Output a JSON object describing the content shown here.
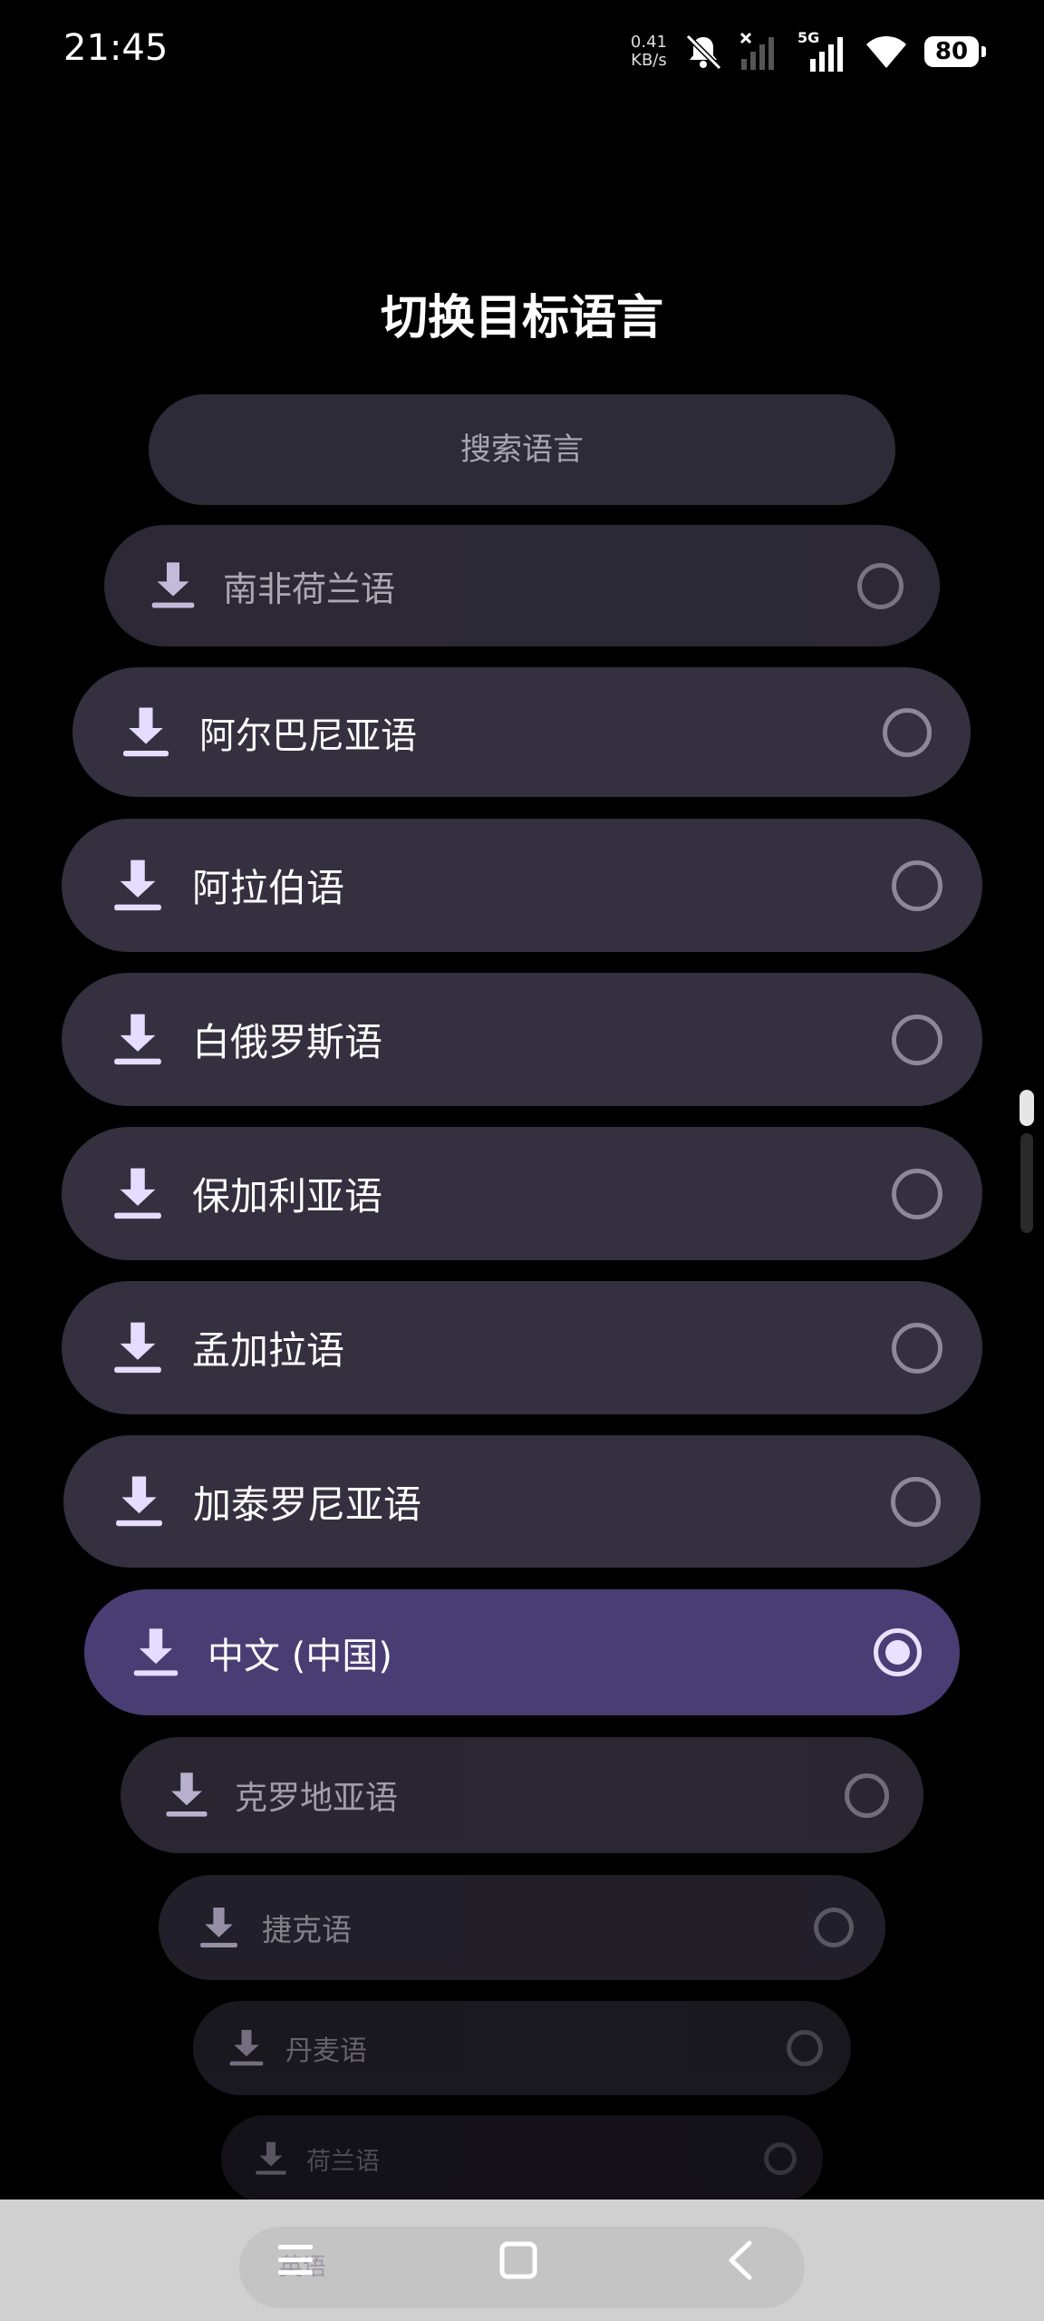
{
  "status_bar": {
    "time": "21:45",
    "net_speed_value": "0.41",
    "net_speed_unit": "KB/s",
    "network_type": "5G",
    "battery": "80",
    "icons": [
      "bell-muted-icon",
      "signal-no-sim-icon",
      "signal-5g-icon",
      "wifi-icon",
      "battery-icon"
    ]
  },
  "dialog": {
    "title": "切换目标语言",
    "search_placeholder": "搜索语言"
  },
  "languages": [
    {
      "label": "南非荷兰语",
      "selected": false
    },
    {
      "label": "阿尔巴尼亚语",
      "selected": false
    },
    {
      "label": "阿拉伯语",
      "selected": false
    },
    {
      "label": "白俄罗斯语",
      "selected": false
    },
    {
      "label": "保加利亚语",
      "selected": false
    },
    {
      "label": "孟加拉语",
      "selected": false
    },
    {
      "label": "加泰罗尼亚语",
      "selected": false
    },
    {
      "label": "中文 (中国)",
      "selected": true
    },
    {
      "label": "克罗地亚语",
      "selected": false
    },
    {
      "label": "捷克语",
      "selected": false
    },
    {
      "label": "丹麦语",
      "selected": false
    },
    {
      "label": "荷兰语",
      "selected": false
    }
  ],
  "nav_bar": {
    "ghost_text": "英语",
    "icons": [
      "menu-icon",
      "home-icon",
      "back-icon"
    ]
  },
  "colors": {
    "row_bg": "#34303f",
    "row_selected_bg": "#4a3d74",
    "accent": "#e9e1ff"
  }
}
